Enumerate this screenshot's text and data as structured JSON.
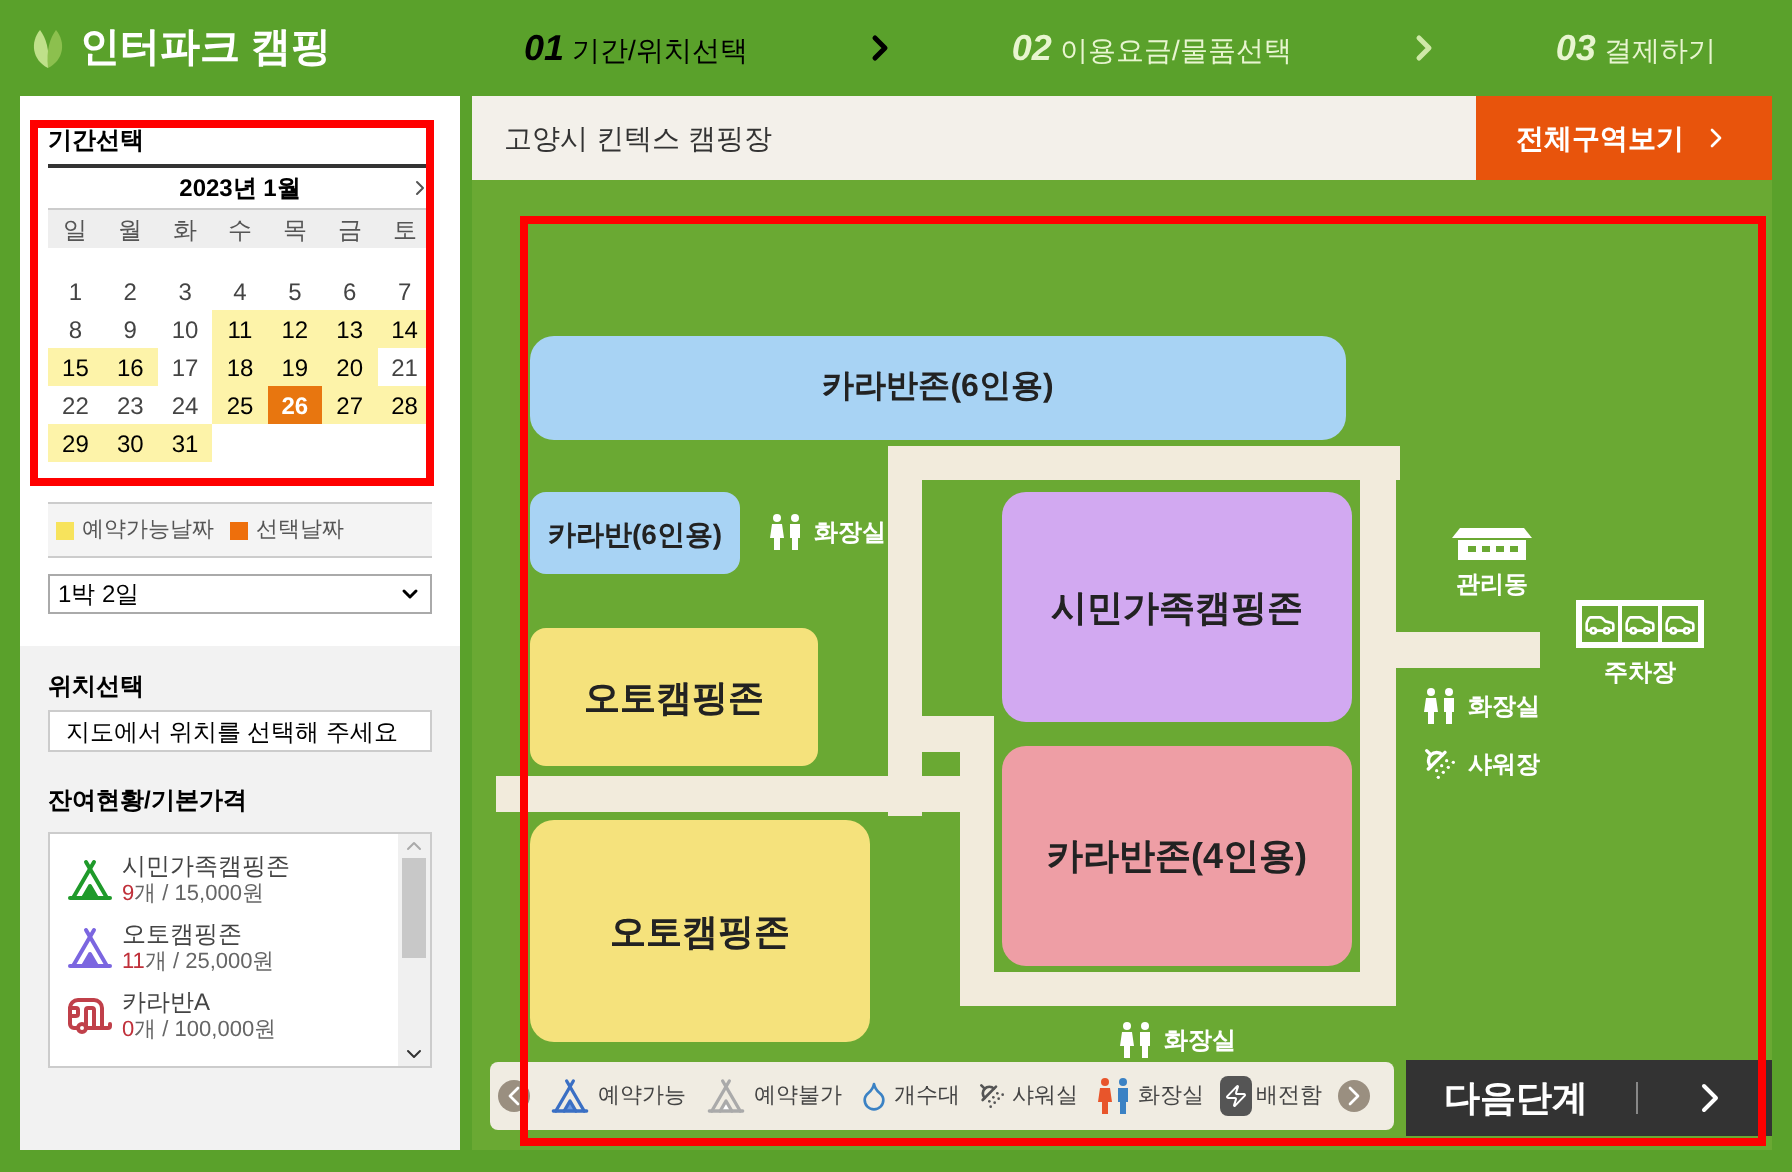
{
  "header": {
    "logo": "인터파크 캠핑",
    "steps": [
      {
        "number": "01",
        "label": "기간/위치선택",
        "selected": true
      },
      {
        "number": "02",
        "label": "이용요금/물품선택",
        "selected": false
      },
      {
        "number": "03",
        "label": "결제하기",
        "selected": false
      }
    ]
  },
  "calendar": {
    "title": "기간선택",
    "month": "2023년  1월",
    "weekdays": [
      "일",
      "월",
      "화",
      "수",
      "목",
      "금",
      "토"
    ],
    "days": [
      {
        "label": "1",
        "available": false,
        "selected": false
      },
      {
        "label": "2",
        "available": false,
        "selected": false
      },
      {
        "label": "3",
        "available": false,
        "selected": false
      },
      {
        "label": "4",
        "available": false,
        "selected": false
      },
      {
        "label": "5",
        "available": false,
        "selected": false
      },
      {
        "label": "6",
        "available": false,
        "selected": false
      },
      {
        "label": "7",
        "available": false,
        "selected": false
      },
      {
        "label": "8",
        "available": false,
        "selected": false
      },
      {
        "label": "9",
        "available": false,
        "selected": false
      },
      {
        "label": "10",
        "available": false,
        "selected": false
      },
      {
        "label": "11",
        "available": true,
        "selected": false
      },
      {
        "label": "12",
        "available": true,
        "selected": false
      },
      {
        "label": "13",
        "available": true,
        "selected": false
      },
      {
        "label": "14",
        "available": true,
        "selected": false
      },
      {
        "label": "15",
        "available": true,
        "selected": false
      },
      {
        "label": "16",
        "available": true,
        "selected": false
      },
      {
        "label": "17",
        "available": false,
        "selected": false
      },
      {
        "label": "18",
        "available": true,
        "selected": false
      },
      {
        "label": "19",
        "available": true,
        "selected": false
      },
      {
        "label": "20",
        "available": true,
        "selected": false
      },
      {
        "label": "21",
        "available": false,
        "selected": false
      },
      {
        "label": "22",
        "available": false,
        "selected": false
      },
      {
        "label": "23",
        "available": false,
        "selected": false
      },
      {
        "label": "24",
        "available": false,
        "selected": false
      },
      {
        "label": "25",
        "available": true,
        "selected": false
      },
      {
        "label": "26",
        "available": true,
        "selected": true
      },
      {
        "label": "27",
        "available": true,
        "selected": false
      },
      {
        "label": "28",
        "available": true,
        "selected": false
      },
      {
        "label": "29",
        "available": true,
        "selected": false
      },
      {
        "label": "30",
        "available": true,
        "selected": false
      },
      {
        "label": "31",
        "available": true,
        "selected": false
      }
    ],
    "legend": [
      {
        "label": "예약가능날짜",
        "color": "#f7e35c"
      },
      {
        "label": "선택날짜",
        "color": "#ee6f0c"
      }
    ]
  },
  "stay_select": {
    "value": "1박 2일"
  },
  "location": {
    "title": "위치선택",
    "value": "지도에서 위치를 선택해 주세요"
  },
  "availability": {
    "title": "잔여현황/기본가격",
    "items": [
      {
        "kind": "tent",
        "color": "#1f9a2a",
        "name": "시민가족캠핑존",
        "count": "9",
        "detail": "개 / 15,000원"
      },
      {
        "kind": "tent",
        "color": "#7b66e0",
        "name": "오토캠핑존",
        "count": "11",
        "detail": "개 / 25,000원"
      },
      {
        "kind": "caravan",
        "color": "#c0404a",
        "name": "카라반A",
        "count": "0",
        "detail": "개 / 100,000원"
      }
    ]
  },
  "map": {
    "title": "고양시 킨텍스 캠핑장",
    "view_all_button": "전체구역보기",
    "zones": [
      {
        "name": "카라반존(6인용)",
        "color": "#a8d3f4"
      },
      {
        "name": "카라반(6인용)",
        "color": "#a8d3f4"
      },
      {
        "name": "오토캠핑존",
        "color": "#f5e27c"
      },
      {
        "name": "오토캠핑존",
        "color": "#f5e27c"
      },
      {
        "name": "시민가족캠핑존",
        "color": "#d2a9f1"
      },
      {
        "name": "카라반존(4인용)",
        "color": "#ee9ea5"
      }
    ],
    "labels": [
      {
        "kind": "restroom",
        "label": "화장실"
      },
      {
        "kind": "office",
        "label": "관리동"
      },
      {
        "kind": "parking",
        "label": "주차장"
      },
      {
        "kind": "restroom",
        "label": "화장실"
      },
      {
        "kind": "shower",
        "label": "샤워장"
      },
      {
        "kind": "restroom",
        "label": "화장실"
      }
    ],
    "legend": [
      {
        "kind": "available",
        "label": "예약가능"
      },
      {
        "kind": "unavailable",
        "label": "예약불가"
      },
      {
        "kind": "sink",
        "label": "개수대"
      },
      {
        "kind": "shower",
        "label": "샤워실"
      },
      {
        "kind": "restroom",
        "label": "화장실"
      },
      {
        "kind": "power",
        "label": "배전함"
      }
    ],
    "next_button": "다음단계"
  }
}
